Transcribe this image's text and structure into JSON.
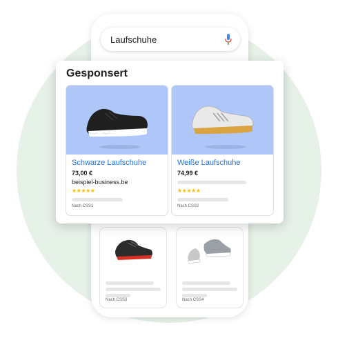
{
  "search": {
    "query": "Laufschuhe",
    "mic_icon": "mic-icon"
  },
  "sponsored": {
    "title": "Gesponsert",
    "cards": [
      {
        "name": "Schwarze Laufschuhe",
        "price": "73,00 €",
        "shop": "beispiel-business.be",
        "rating": 4.5,
        "stars": "★★★★★",
        "label": "Nach CSS1"
      },
      {
        "name": "Weiße Laufschuhe",
        "price": "74,99 €",
        "shop": "",
        "rating": 4.5,
        "stars": "★★★★★",
        "label": "Nach CSS2"
      }
    ]
  },
  "results": [
    {
      "label": "Nach CSS3"
    },
    {
      "label": "Nach CSS4"
    }
  ],
  "colors": {
    "link": "#1a73e8",
    "star": "#fbbc04",
    "image_bg": "#aec7f8",
    "background_circle": "#e6f1e8",
    "mic_blue": "#4285f4",
    "mic_red": "#ea4335"
  }
}
